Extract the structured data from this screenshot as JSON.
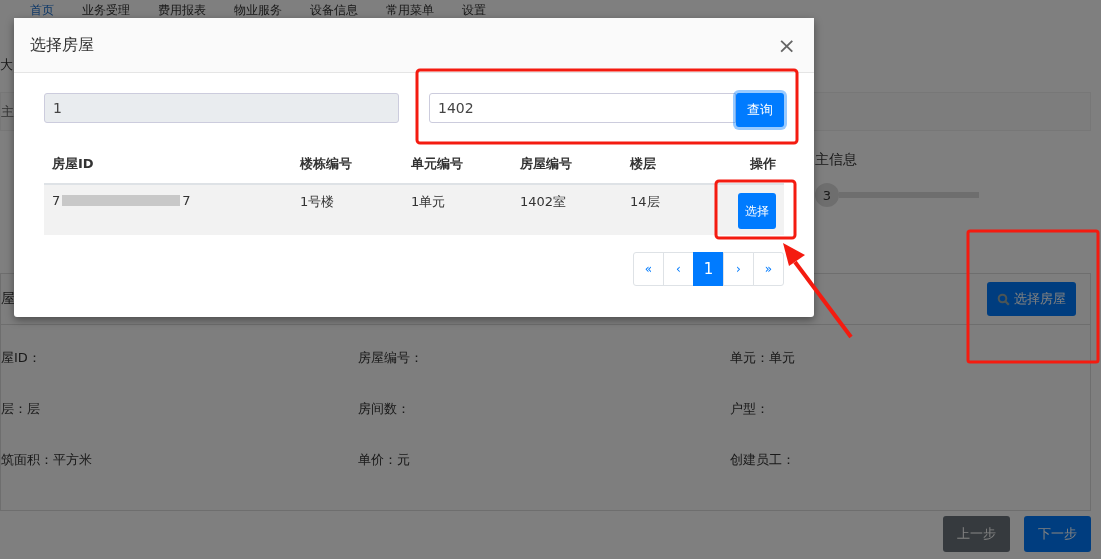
{
  "nav": [
    {
      "label": "首页",
      "selected": true
    },
    {
      "label": "业务受理",
      "selected": false
    },
    {
      "label": "费用报表",
      "selected": false
    },
    {
      "label": "物业服务",
      "selected": false
    },
    {
      "label": "设备信息",
      "selected": false
    },
    {
      "label": "常用菜单",
      "selected": false
    },
    {
      "label": "设置",
      "selected": false
    }
  ],
  "breadcrumb": "大",
  "search_bar": {
    "text": "主"
  },
  "steps": {
    "label": "主信息",
    "current_step": "3"
  },
  "house_section": {
    "title": "屋",
    "select_button": "选择房屋",
    "fields": [
      {
        "label": "屋ID："
      },
      {
        "label": "房屋编号："
      },
      {
        "label": "单元：",
        "value": "单元"
      },
      {
        "label": "层：",
        "value": "层"
      },
      {
        "label": "房间数："
      },
      {
        "label": "户型："
      },
      {
        "label": "筑面积：",
        "value": "平方米"
      },
      {
        "label": "单价：",
        "value": "元"
      },
      {
        "label": "创建员工："
      }
    ]
  },
  "footer_buttons": [
    {
      "label": "上一步",
      "kind": "secondary"
    },
    {
      "label": "下一步",
      "kind": "primary"
    }
  ],
  "modal": {
    "title": "选择房屋",
    "close": "×",
    "filter_value": "1",
    "search_value": "1402",
    "search_button": "查询",
    "columns": [
      "房屋ID",
      "楼栋编号",
      "单元编号",
      "房屋编号",
      "楼层",
      "操作"
    ],
    "rows": [
      {
        "id_start": "7",
        "id_end": "7",
        "building": "1号楼",
        "unit": "1单元",
        "room": "1402室",
        "floor": "14层",
        "action": "选择"
      }
    ],
    "pagination": [
      {
        "label": "«",
        "selected": false
      },
      {
        "label": "‹",
        "selected": false
      },
      {
        "label": "1",
        "selected": true
      },
      {
        "label": "›",
        "selected": false
      },
      {
        "label": "»",
        "selected": false
      }
    ]
  }
}
